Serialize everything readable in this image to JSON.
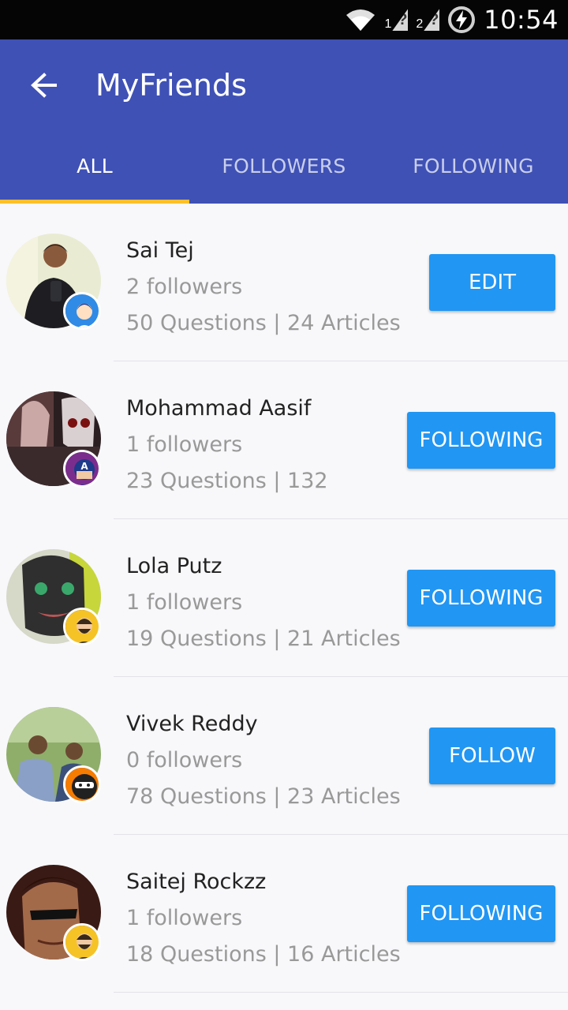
{
  "status_bar": {
    "time": "10:54",
    "sim1": "1",
    "sim2": "2"
  },
  "app_bar": {
    "title": "MyFriends"
  },
  "tabs": [
    {
      "label": "ALL",
      "active": true
    },
    {
      "label": "FOLLOWERS",
      "active": false
    },
    {
      "label": "FOLLOWING",
      "active": false
    }
  ],
  "friends": [
    {
      "name": "Sai Tej",
      "followers": "2 followers",
      "stats": "50 Questions | 24 Articles",
      "action": "EDIT"
    },
    {
      "name": "Mohammad Aasif",
      "followers": "1 followers",
      "stats": "23 Questions | 132",
      "action": "FOLLOWING"
    },
    {
      "name": "Lola Putz",
      "followers": "1 followers",
      "stats": "19 Questions | 21 Articles",
      "action": "FOLLOWING"
    },
    {
      "name": "Vivek Reddy",
      "followers": "0 followers",
      "stats": "78 Questions | 23 Articles",
      "action": "FOLLOW"
    },
    {
      "name": "Saitej Rockzz",
      "followers": "1 followers",
      "stats": "18 Questions | 16 Articles",
      "action": "FOLLOWING"
    }
  ],
  "colors": {
    "app_bar": "#3f51b5",
    "tab_indicator": "#fbc02d",
    "button": "#2196f3"
  }
}
